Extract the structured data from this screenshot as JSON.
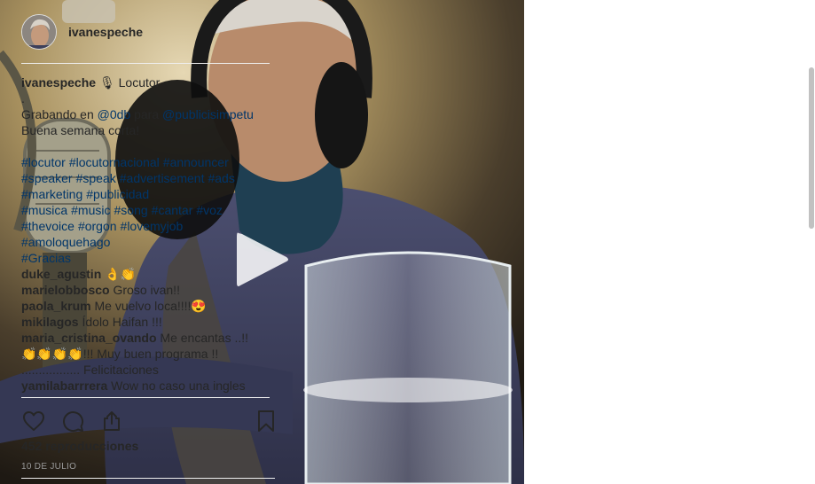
{
  "post": {
    "username": "ivanespeche",
    "views": "452 reproducciones",
    "date": "10 DE JULIO"
  },
  "caption": {
    "username": "ivanespeche",
    "emoji": "🎙",
    "title": "Locutor",
    "dot": ".",
    "line2_a": "Grabando en ",
    "mention1": "@0db",
    "line2_b": " para ",
    "mention2": "@publicisimpetu",
    "line3": "Buena semana corta!",
    "tag_rows": [
      [
        "#locutor",
        "#locutornacional",
        "#announcer"
      ],
      [
        "#speaker",
        "#speak",
        "#advertisement",
        "#ads"
      ],
      [
        "#marketing",
        "#publicidad"
      ],
      [
        "#musica",
        "#music",
        "#song",
        "#cantar",
        "#voz"
      ],
      [
        "#thevoice",
        "#orgon",
        "#lovemyjob"
      ],
      [
        "#amoloquehago"
      ],
      [
        "#Gracias"
      ]
    ]
  },
  "comments": [
    {
      "user": "duke_agustin",
      "text": " 👌👏"
    },
    {
      "user": "marielobbosco",
      "text": " Groso ivan!!"
    },
    {
      "user": "paola_krum",
      "text": " Me vuelvo loca!!!!😍"
    },
    {
      "user": "mikilagos",
      "text": " Ídolo Haifan !!!"
    },
    {
      "user": "maria_cristina_ovando",
      "text": " Me encantas ..!!",
      "cont": [
        "👏👏👏👏!!! Muy buen programa !!",
        "................. Felicitaciones"
      ]
    },
    {
      "user": "yamilabarrrera",
      "text": " Wow no caso una ingles"
    }
  ],
  "icons": {
    "like": "heart-icon",
    "comment": "comment-icon",
    "share": "share-icon",
    "save": "bookmark-icon",
    "play": "play-icon"
  },
  "colors": {
    "link": "#003569",
    "text": "#262626",
    "muted": "#999999",
    "border": "#efefef"
  }
}
